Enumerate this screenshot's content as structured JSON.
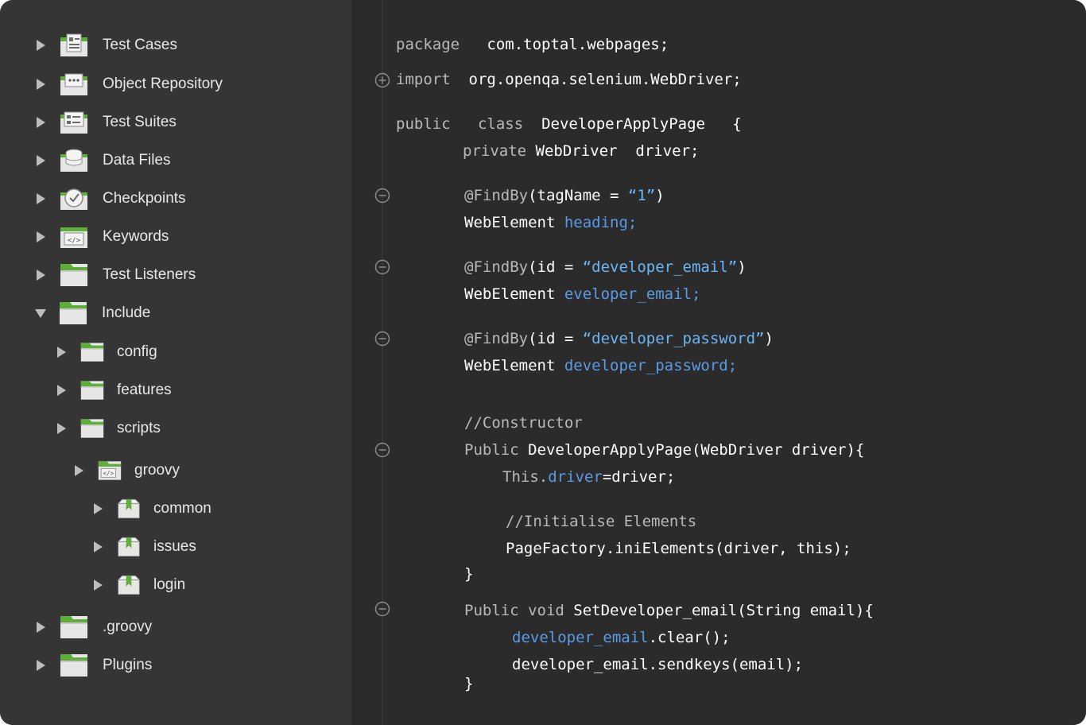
{
  "tree": {
    "items": [
      {
        "label": "Test Cases",
        "icon": "test-cases-icon"
      },
      {
        "label": "Object Repository",
        "icon": "object-repository-icon"
      },
      {
        "label": "Test Suites",
        "icon": "test-suites-icon"
      },
      {
        "label": "Data Files",
        "icon": "data-files-icon"
      },
      {
        "label": "Checkpoints",
        "icon": "checkpoints-icon"
      },
      {
        "label": "Keywords",
        "icon": "keywords-icon"
      },
      {
        "label": "Test Listeners",
        "icon": "folder-icon"
      },
      {
        "label": "Include",
        "icon": "folder-icon",
        "expanded": true
      },
      {
        "label": "config",
        "icon": "folder-icon"
      },
      {
        "label": "features",
        "icon": "folder-icon"
      },
      {
        "label": "scripts",
        "icon": "folder-icon"
      },
      {
        "label": "groovy",
        "icon": "code-folder-icon"
      },
      {
        "label": "common",
        "icon": "package-icon"
      },
      {
        "label": "issues",
        "icon": "package-icon"
      },
      {
        "label": "login",
        "icon": "package-icon"
      },
      {
        "label": ".groovy",
        "icon": "folder-icon"
      },
      {
        "label": "Plugins",
        "icon": "folder-icon"
      }
    ]
  },
  "code": {
    "l1": {
      "kw": "package",
      "t": "com.toptal.webpages;"
    },
    "l2": {
      "kw": "import",
      "t": "org.openqa.selenium.WebDriver;"
    },
    "l3": {
      "kw1": "public",
      "kw2": "class",
      "t": "DeveloperApplyPage",
      "b": "{"
    },
    "l4": {
      "kw": "private",
      "t1": "WebDriver",
      "t2": "driver;"
    },
    "l5": {
      "kw": "@FindBy",
      "t1": "(tagName = ",
      "s": "“1”",
      "t2": ")"
    },
    "l6": {
      "t": "WebElement",
      "id": "heading;"
    },
    "l7": {
      "kw": "@FindBy",
      "t1": "(id = ",
      "s": "“developer_email”",
      "t2": ")"
    },
    "l8": {
      "t": "WebElement",
      "id": "eveloper_email;"
    },
    "l9": {
      "kw": "@FindBy",
      "t1": "(id = ",
      "s": "“developer_password”",
      "t2": ")"
    },
    "l10": {
      "t": "WebElement",
      "id": "developer_password;"
    },
    "l11": {
      "cm": "//Constructor"
    },
    "l12": {
      "kw": "Public",
      "t": "DeveloperApplyPage(WebDriver driver){"
    },
    "l13": {
      "kw": "This.",
      "id": "driver",
      "t": "=driver;"
    },
    "l14": {
      "cm": "//Initialise Elements"
    },
    "l15": {
      "t": "PageFactory.iniElements(driver, this);"
    },
    "l16": {
      "t": "}"
    },
    "l17": {
      "kw": "Public void",
      "t": "SetDeveloper_email(String email){"
    },
    "l18": {
      "id": "developer_email",
      "t": ".clear();"
    },
    "l19": {
      "t": "developer_email.sendkeys(email);"
    },
    "l20": {
      "t": "}"
    }
  },
  "colors": {
    "sidebar_bg": "#353535",
    "editor_bg": "#2b2b2b",
    "accent_green": "#5fae3a",
    "string_blue": "#6bb6f6",
    "identifier_blue": "#5a9be6"
  }
}
